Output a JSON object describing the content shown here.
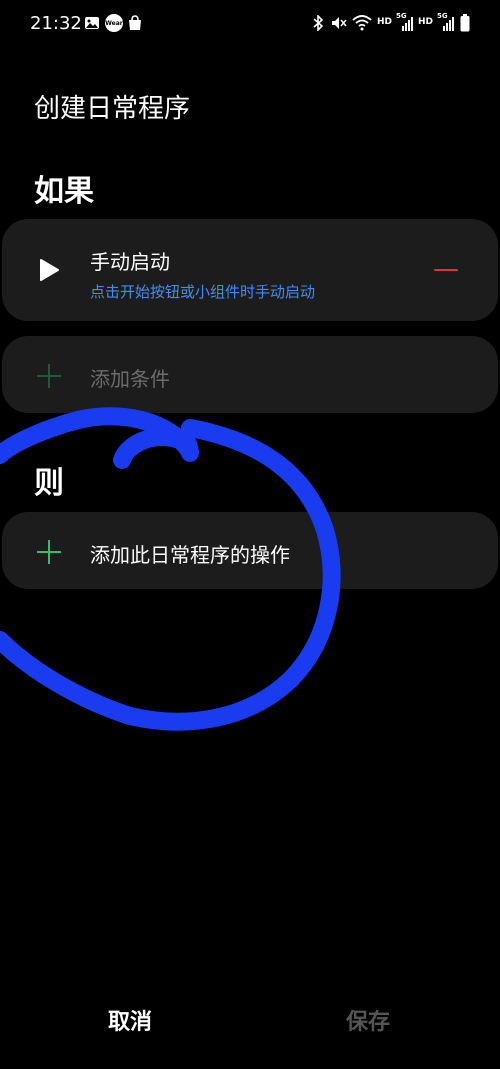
{
  "status_bar": {
    "time": "21:32",
    "app_icon_label": "Wear",
    "network_hd_1": "HD",
    "network_5g_1": "5G",
    "network_hd_2": "HD",
    "network_5g_2": "5G"
  },
  "page": {
    "title": "创建日常程序"
  },
  "if_section": {
    "title": "如果",
    "trigger": {
      "title": "手动启动",
      "subtitle": "点击开始按钮或小组件时手动启动"
    },
    "add_condition_label": "添加条件"
  },
  "then_section": {
    "title": "则",
    "add_action_label": "添加此日常程序的操作"
  },
  "footer": {
    "cancel_label": "取消",
    "save_label": "保存"
  },
  "colors": {
    "background": "#000000",
    "card": "#1c1c1c",
    "accent_green": "#2fbf71",
    "subtitle_blue": "#3f8ef5",
    "remove_red": "#e0313c",
    "annotation_blue": "#1a3cf0"
  }
}
